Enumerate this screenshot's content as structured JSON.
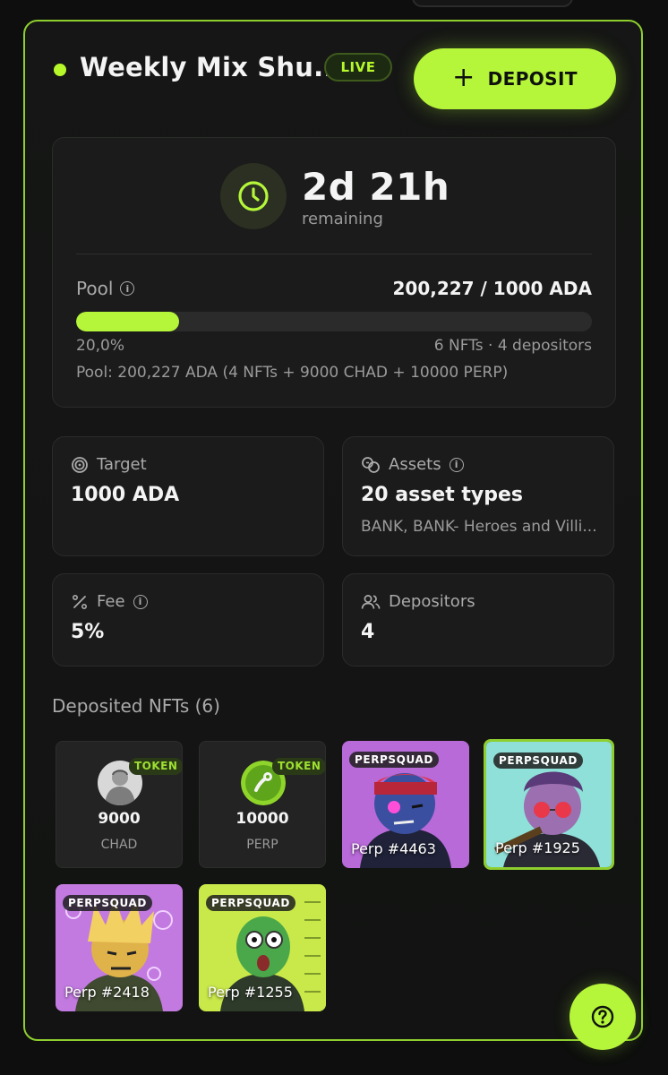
{
  "header": {
    "title": "Weekly Mix Shu...",
    "status_badge": "LIVE",
    "deposit_icon": "+",
    "deposit_label": "DEPOSIT"
  },
  "timer": {
    "icon": "clock-icon",
    "value": "2d  21h",
    "label": "remaining"
  },
  "pool": {
    "label": "Pool",
    "value": "200,227 / 1000 ADA",
    "progress": 0.2,
    "percent_label": "20,0%",
    "nfts_depositors": "6 NFTs · 4 depositors",
    "detail": "Pool: 200,227 ADA (4 NFTs + 9000 CHAD + 10000 PERP)"
  },
  "stats": {
    "target": {
      "icon": "target-icon",
      "label": "Target",
      "value": "1000 ADA"
    },
    "assets": {
      "icon": "coins-icon",
      "label": "Assets",
      "value": "20 asset types",
      "sub": "BANK, BANK- Heroes and Villi..."
    },
    "fee": {
      "icon": "percent-icon",
      "label": "Fee",
      "value": "5%"
    },
    "depositors": {
      "icon": "users-icon",
      "label": "Depositors",
      "value": "4"
    }
  },
  "deposited": {
    "title": "Deposited NFTs (6)",
    "tokens": [
      {
        "badge": "TOKEN",
        "amount": "9000",
        "name": "CHAD"
      },
      {
        "badge": "TOKEN",
        "amount": "10000",
        "name": "PERP"
      }
    ],
    "nfts": [
      {
        "badge": "PERPSQUAD",
        "label": "Perp #4463"
      },
      {
        "badge": "PERPSQUAD",
        "label": "Perp #1925"
      },
      {
        "badge": "PERPSQUAD",
        "label": "Perp #2418"
      },
      {
        "badge": "PERPSQUAD",
        "label": "Perp #1255"
      }
    ]
  },
  "help": {
    "icon": "question-icon"
  },
  "colors": {
    "accent": "#b5f53a",
    "border": "#8ecf2f",
    "background": "#0d0e0d",
    "card": "#1a1b1a"
  }
}
